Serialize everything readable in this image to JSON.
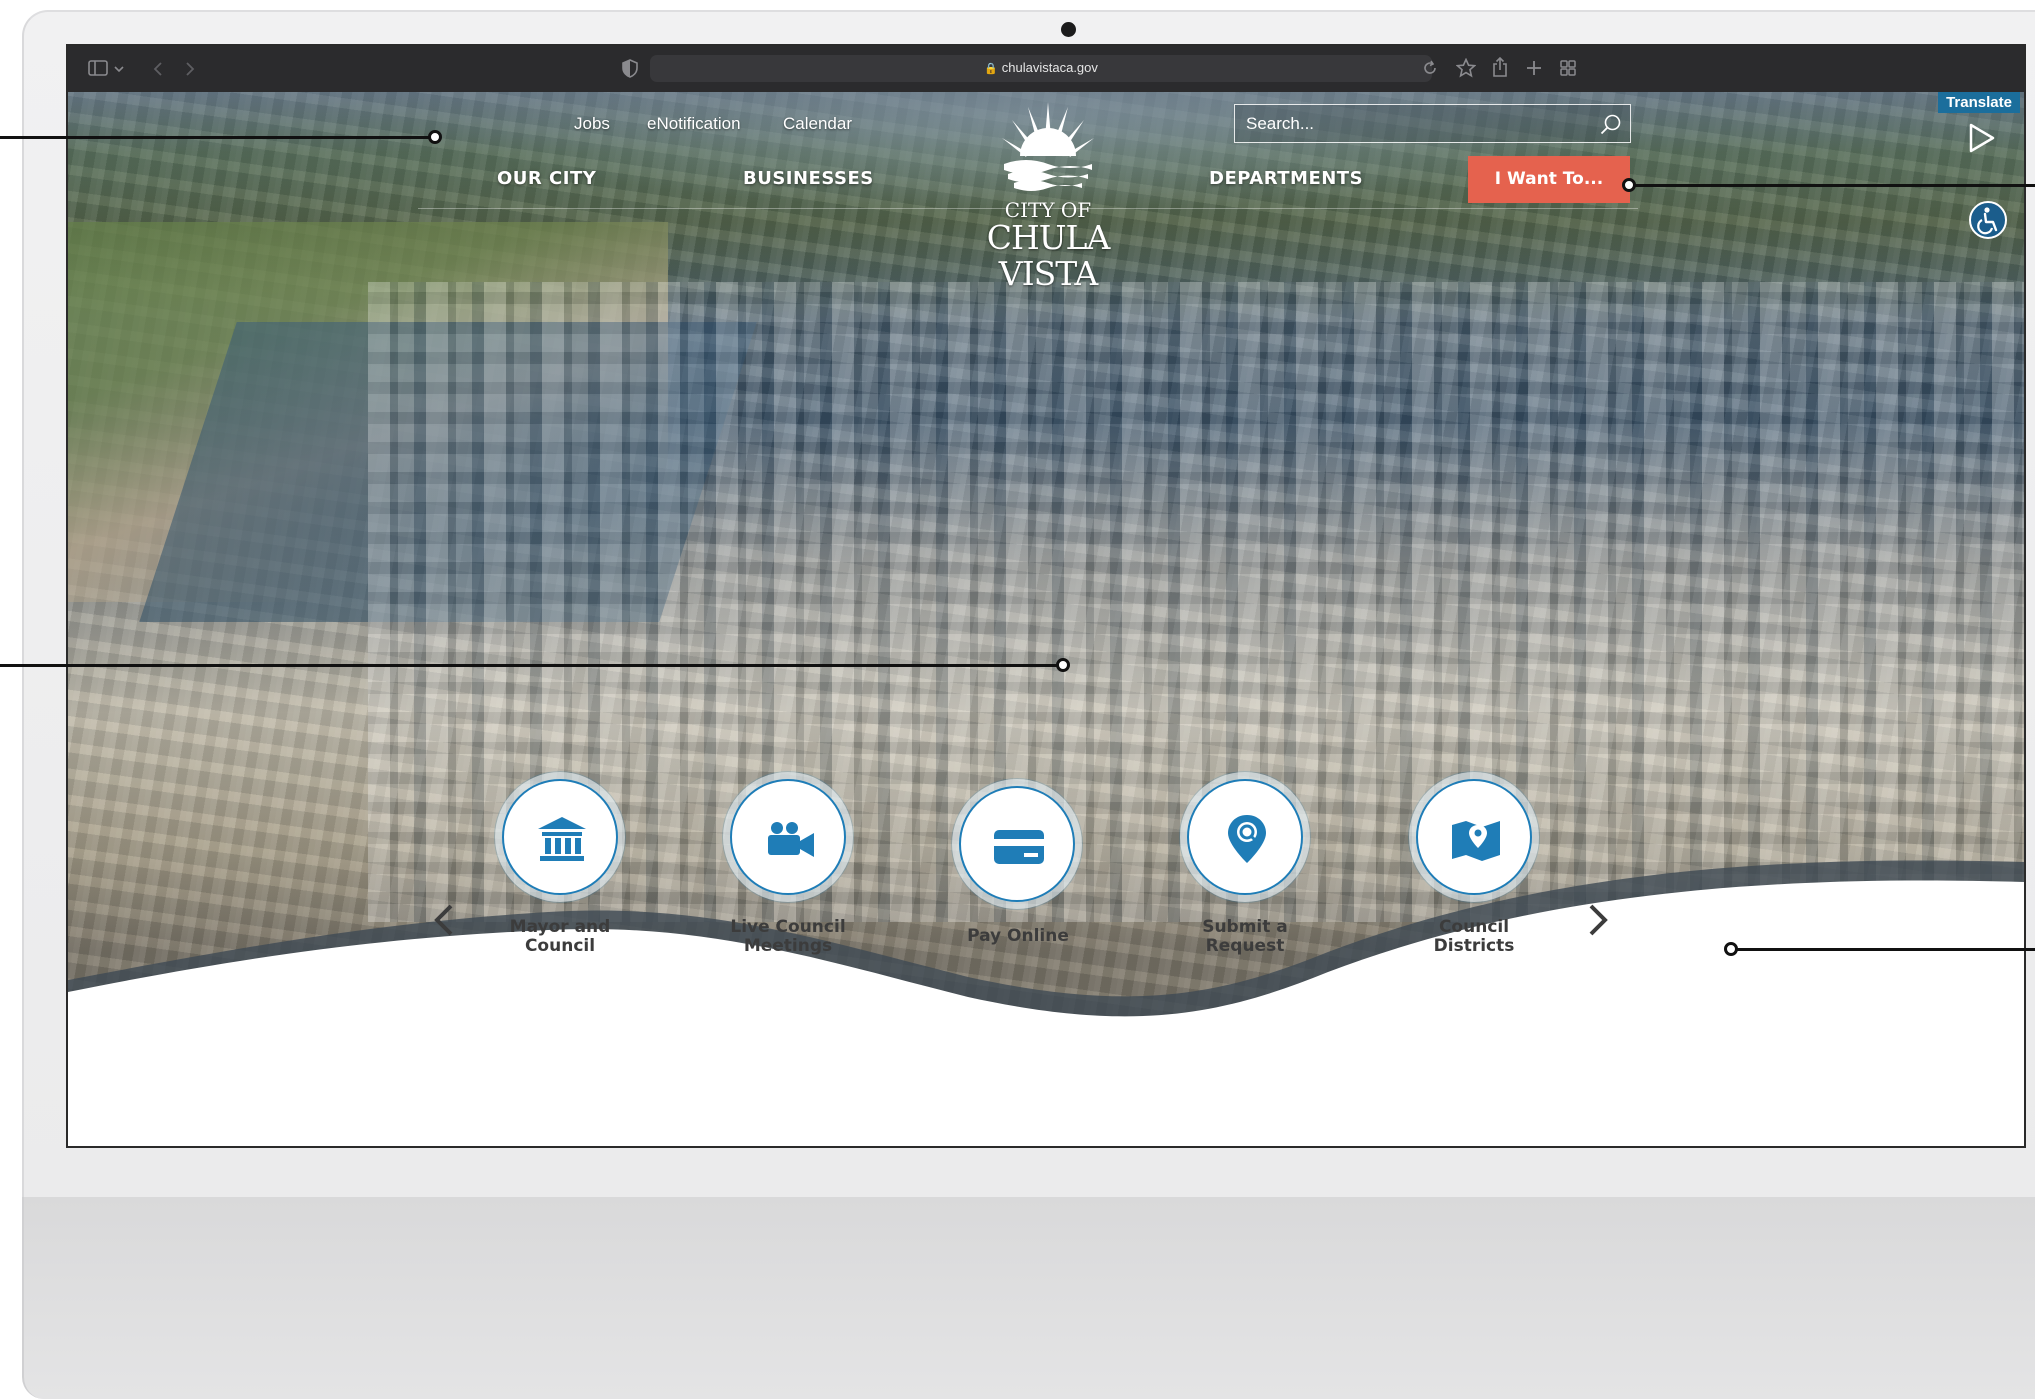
{
  "browser": {
    "url": "chulavistaca.gov",
    "toolbar_icons": [
      "sidebar-icon",
      "chevron-down-icon",
      "back-icon",
      "forward-icon",
      "shield-icon",
      "reload-icon",
      "star-icon",
      "share-icon",
      "new-tab-icon",
      "tab-overview-icon"
    ]
  },
  "header": {
    "utility_links": [
      "Jobs",
      "eNotification",
      "Calendar"
    ],
    "search": {
      "placeholder": "Search...",
      "value": ""
    },
    "nav": [
      "OUR CITY",
      "BUSINESSES",
      "DEPARTMENTS"
    ],
    "cta_label": "I Want To...",
    "logo": {
      "line1": "CITY OF",
      "line2": "CHULA VISTA"
    }
  },
  "side_tools": {
    "translate_label": "Translate"
  },
  "quick_links": [
    {
      "line1": "Mayor and",
      "line2": "Council",
      "icon": "city-hall-icon"
    },
    {
      "line1": "Live Council",
      "line2": "Meetings",
      "icon": "video-camera-icon"
    },
    {
      "line1": "Pay Online",
      "line2": "",
      "icon": "credit-card-icon"
    },
    {
      "line1": "Submit a",
      "line2": "Request",
      "icon": "map-pin-search-icon"
    },
    {
      "line1": "Council",
      "line2": "Districts",
      "icon": "district-map-icon"
    }
  ],
  "colors": {
    "accent_orange": "#e5624e",
    "accent_blue": "#1f7db7",
    "translate_bg": "#1b6e9c"
  }
}
